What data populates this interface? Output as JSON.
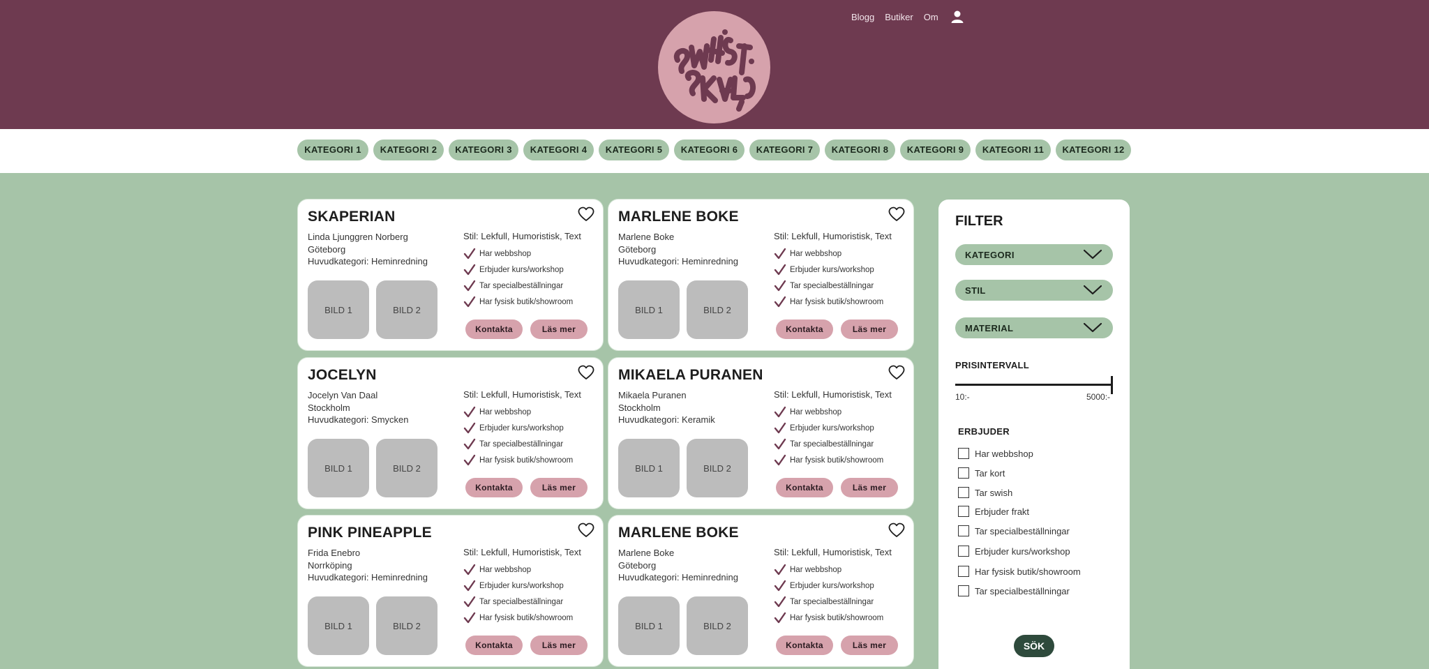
{
  "logo": {
    "alt_text": "SMÅSKALIGT"
  },
  "topnav": {
    "items": [
      "Blogg",
      "Butiker",
      "Om"
    ]
  },
  "categories": [
    "KATEGORI 1",
    "KATEGORI 2",
    "KATEGORI 3",
    "KATEGORI 4",
    "KATEGORI 5",
    "KATEGORI 6",
    "KATEGORI 7",
    "KATEGORI 8",
    "KATEGORI 9",
    "KATEGORI 11",
    "KATEGORI 12"
  ],
  "cards": [
    {
      "title": "SKAPERIAN",
      "owner": "Linda Ljunggren Norberg",
      "city": "Göteborg",
      "main_category": "Huvudkategori: Heminredning",
      "style": "Stil: Lekfull, Humoristisk, Text"
    },
    {
      "title": "MARLENE BOKE",
      "owner": "Marlene Boke",
      "city": "Göteborg",
      "main_category": "Huvudkategori: Heminredning",
      "style": "Stil: Lekfull, Humoristisk, Text"
    },
    {
      "title": "JOCELYN",
      "owner": "Jocelyn Van Daal",
      "city": "Stockholm",
      "main_category": "Huvudkategori: Smycken",
      "style": "Stil: Lekfull, Humoristisk, Text"
    },
    {
      "title": "MIKAELA PURANEN",
      "owner": "Mikaela Puranen",
      "city": "Stockholm",
      "main_category": "Huvudkategori: Keramik",
      "style": "Stil: Lekfull, Humoristisk, Text"
    },
    {
      "title": "PINK PINEAPPLE",
      "owner": "Frida Enebro",
      "city": "Norrköping",
      "main_category": "Huvudkategori: Heminredning",
      "style": "Stil: Lekfull, Humoristisk, Text"
    },
    {
      "title": "MARLENE BOKE",
      "owner": "Marlene Boke",
      "city": "Göteborg",
      "main_category": "Huvudkategori: Heminredning",
      "style": "Stil: Lekfull, Humoristisk, Text"
    }
  ],
  "card_common": {
    "features": [
      "Har webbshop",
      "Erbjuder kurs/workshop",
      "Tar specialbeställningar",
      "Har fysisk butik/showroom"
    ],
    "image1": "BILD 1",
    "image2": "BILD 2",
    "contact_label": "Kontakta",
    "read_more_label": "Läs mer"
  },
  "filter": {
    "title": "FILTER",
    "dropdowns": [
      "KATEGORI",
      "STIL",
      "MATERIAL"
    ],
    "price_title": "PRISINTERVALL",
    "price_min": "10:-",
    "price_max": "5000:-",
    "offers_title": "ERBJUDER",
    "offers": [
      "Har webbshop",
      "Tar kort",
      "Tar swish",
      "Erbjuder frakt",
      "Tar specialbeställningar",
      "Erbjuder kurs/workshop",
      "Har fysisk butik/showroom",
      "Tar specialbeställningar"
    ],
    "search_label": "SÖK"
  },
  "colors": {
    "header": "#6e3a50",
    "accent_pink": "#d6a2ac",
    "green": "#a6c4a8",
    "dark_green": "#2e4a3c"
  }
}
